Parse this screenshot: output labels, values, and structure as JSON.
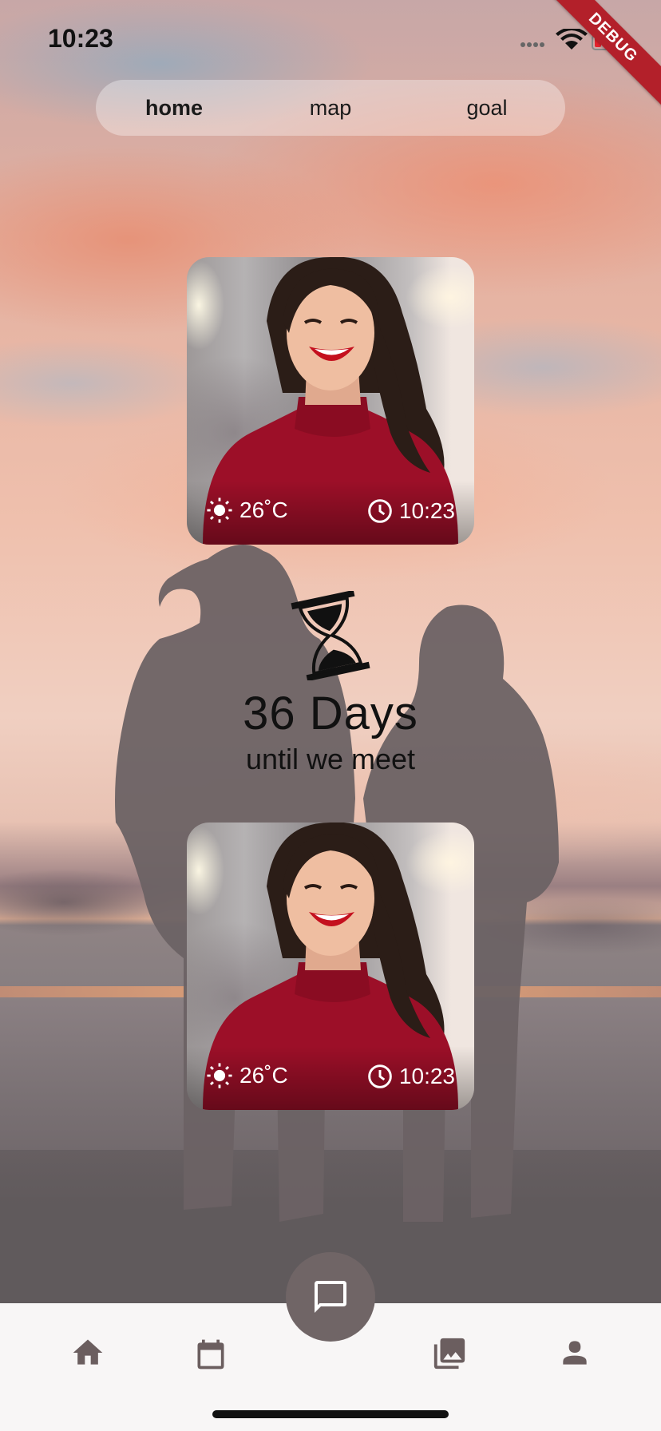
{
  "status_bar": {
    "time": "10:23",
    "debug_label": "DEBUG"
  },
  "tabs": [
    {
      "label": "home",
      "active": true
    },
    {
      "label": "map",
      "active": false
    },
    {
      "label": "goal",
      "active": false
    }
  ],
  "cards": [
    {
      "temperature": "26˚C",
      "time": "10:23",
      "weather_icon": "sun-icon",
      "clock_icon": "clock-icon"
    },
    {
      "temperature": "26˚C",
      "time": "10:23",
      "weather_icon": "sun-icon",
      "clock_icon": "clock-icon"
    }
  ],
  "countdown": {
    "days_text": "36 Days",
    "subtitle": "until we meet",
    "icon": "hourglass-icon"
  },
  "bottom_nav": {
    "items": [
      "home-icon",
      "calendar-icon",
      "chat-icon",
      "photo-library-icon",
      "person-icon"
    ],
    "fab_color": "#706566",
    "icon_color": "#6b5e5f"
  }
}
